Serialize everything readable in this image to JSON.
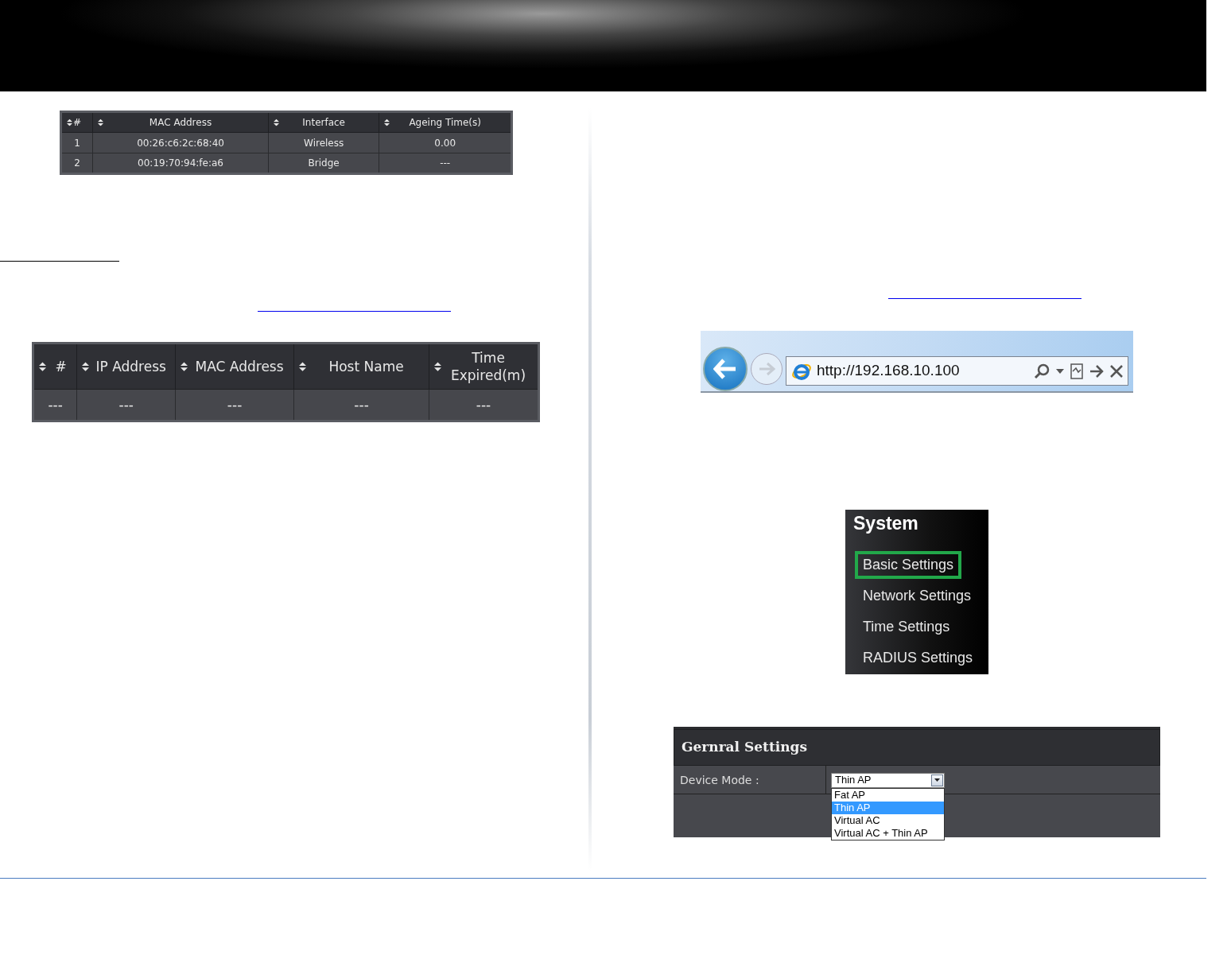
{
  "arp_table": {
    "columns": [
      {
        "label": "#"
      },
      {
        "label": "MAC Address"
      },
      {
        "label": "Interface"
      },
      {
        "label": "Ageing Time(s)"
      }
    ],
    "rows": [
      [
        "1",
        "00:26:c6:2c:68:40",
        "Wireless",
        "0.00"
      ],
      [
        "2",
        "00:19:70:94:fe:a6",
        "Bridge",
        "---"
      ]
    ]
  },
  "dhcp_table": {
    "columns": [
      {
        "label": "#"
      },
      {
        "label": "IP Address"
      },
      {
        "label": "MAC Address"
      },
      {
        "label": "Host Name"
      },
      {
        "label": "Time Expired(m)"
      }
    ],
    "rows": [
      [
        "---",
        "---",
        "---",
        "---",
        "---"
      ]
    ]
  },
  "browser": {
    "url": "http://192.168.10.100"
  },
  "system_menu": {
    "title": "System",
    "items": [
      {
        "label": "Basic Settings",
        "selected": true
      },
      {
        "label": "Network Settings",
        "selected": false
      },
      {
        "label": "Time Settings",
        "selected": false
      },
      {
        "label": "RADIUS Settings",
        "selected": false
      }
    ]
  },
  "general_settings": {
    "title": "Gernral Settings",
    "field_label": "Device Mode :",
    "value": "Thin AP",
    "expanded": true,
    "options": [
      {
        "label": "Fat AP",
        "selected": false
      },
      {
        "label": "Thin AP",
        "selected": true
      },
      {
        "label": "Virtual AC",
        "selected": false
      },
      {
        "label": "Virtual AC + Thin AP",
        "selected": false
      }
    ]
  }
}
